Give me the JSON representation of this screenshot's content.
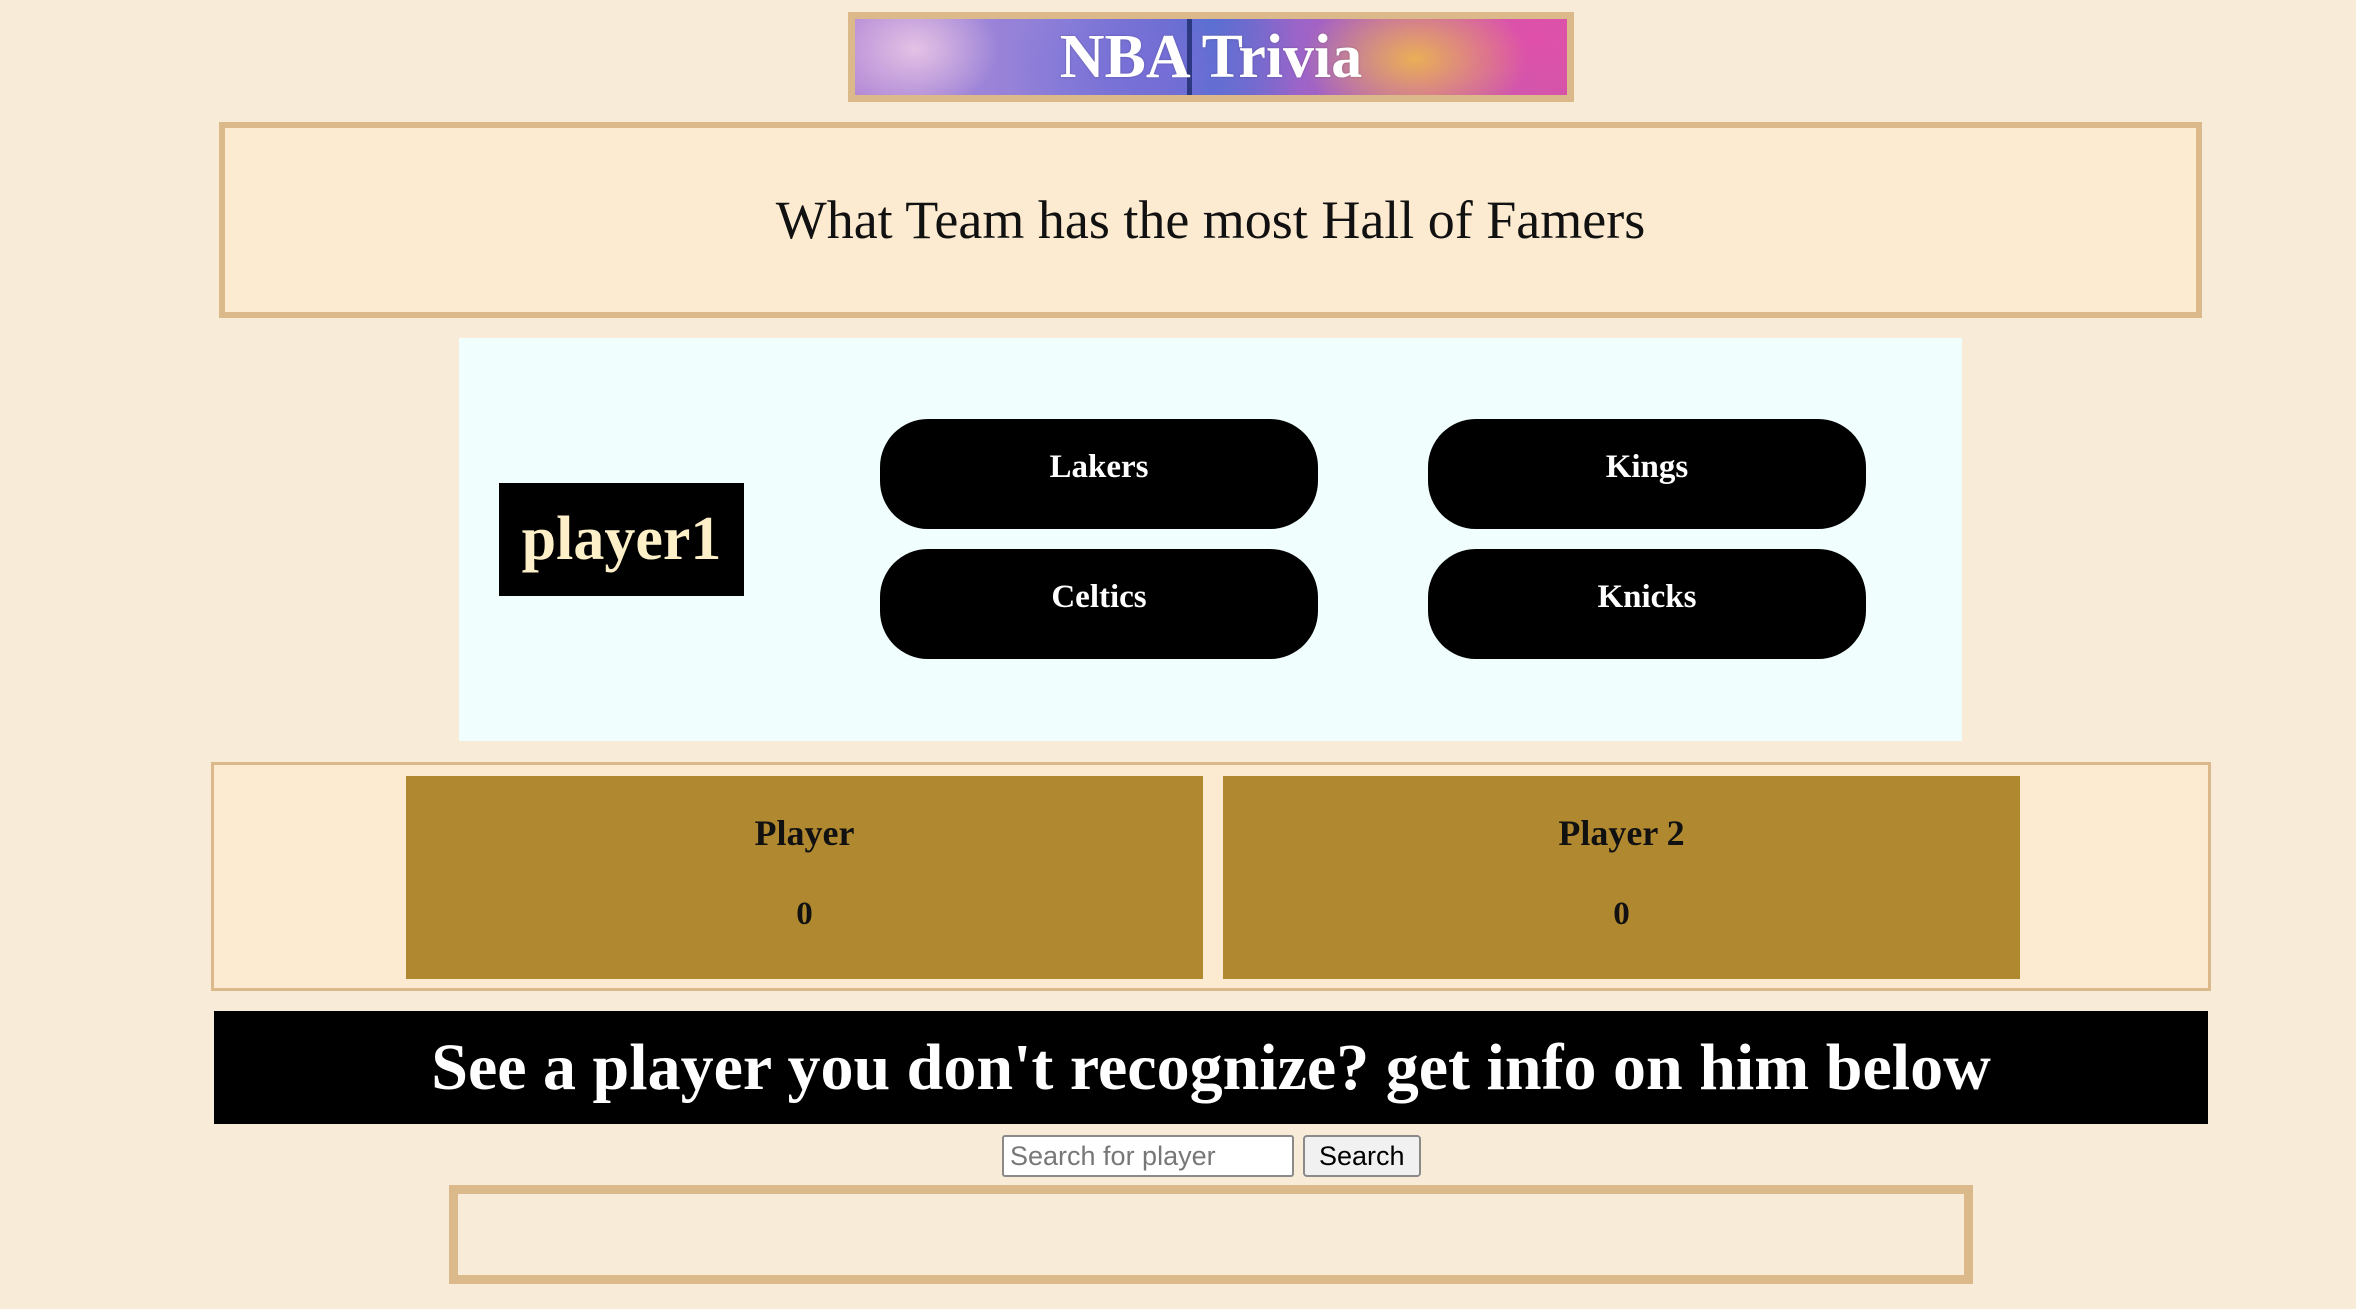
{
  "header": {
    "title": "NBA Trivia"
  },
  "question": {
    "text": "What Team has the most Hall of Famers"
  },
  "game": {
    "current_player": "player1",
    "answers": [
      {
        "label": "Lakers"
      },
      {
        "label": "Kings"
      },
      {
        "label": "Celtics"
      },
      {
        "label": "Knicks"
      }
    ]
  },
  "scoreboard": {
    "players": [
      {
        "name": "Player",
        "score": "0"
      },
      {
        "name": "Player 2",
        "score": "0"
      }
    ]
  },
  "info": {
    "banner_text": "See a player you don't recognize? get info on him below"
  },
  "search": {
    "placeholder": "Search for player",
    "value": "",
    "button_label": "Search"
  },
  "colors": {
    "page_background": "#f8ebd8",
    "panel_border": "#dcb98b",
    "score_card": "#b08830",
    "game_panel": "#f1fefe",
    "button": "#000000"
  }
}
